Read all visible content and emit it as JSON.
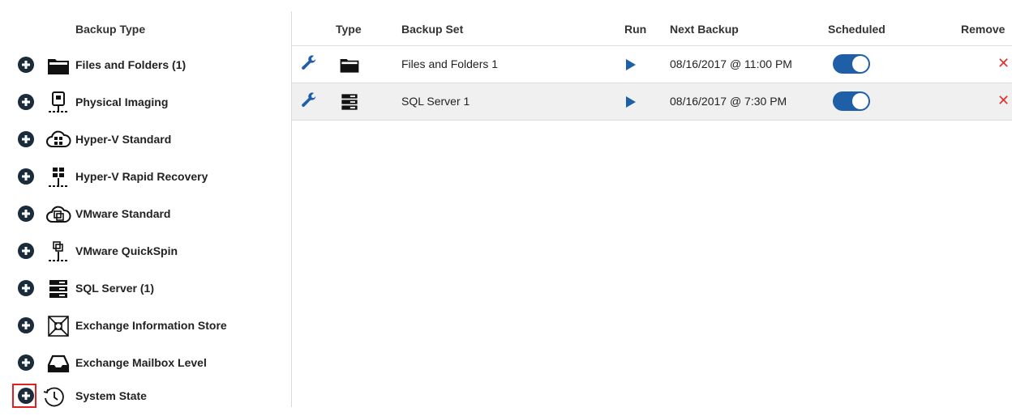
{
  "left_panel": {
    "header": "Backup Type",
    "items": [
      {
        "label": "Files and Folders (1)",
        "icon": "folder-icon"
      },
      {
        "label": "Physical Imaging",
        "icon": "physical-server-icon"
      },
      {
        "label": "Hyper-V Standard",
        "icon": "hyperv-cloud-icon"
      },
      {
        "label": "Hyper-V Rapid Recovery",
        "icon": "hyperv-network-icon"
      },
      {
        "label": "VMware Standard",
        "icon": "vmware-cloud-icon"
      },
      {
        "label": "VMware QuickSpin",
        "icon": "vmware-network-icon"
      },
      {
        "label": "SQL Server (1)",
        "icon": "sql-server-icon"
      },
      {
        "label": "Exchange Information Store",
        "icon": "exchange-store-icon"
      },
      {
        "label": "Exchange Mailbox Level",
        "icon": "mailbox-tray-icon"
      },
      {
        "label": "System State",
        "icon": "history-clock-icon"
      }
    ],
    "add_icon": "plus-circle-icon"
  },
  "table": {
    "columns": [
      "Type",
      "Backup Set",
      "Run",
      "Next Backup",
      "Scheduled",
      "Remove"
    ],
    "rows": [
      {
        "type_icon": "folder-icon",
        "backup_set": "Files and Folders 1",
        "next_backup": "08/16/2017 @ 11:00 PM",
        "scheduled": true,
        "remove": "✕"
      },
      {
        "type_icon": "sql-server-icon",
        "backup_set": "SQL Server 1",
        "next_backup": "08/16/2017 @ 7:30 PM",
        "scheduled": true,
        "remove": "✕"
      }
    ]
  },
  "colors": {
    "accent": "#1f5fa8",
    "remove": "#e53030",
    "highlight": "#e02020",
    "row_alt": "#f0f0f0"
  }
}
